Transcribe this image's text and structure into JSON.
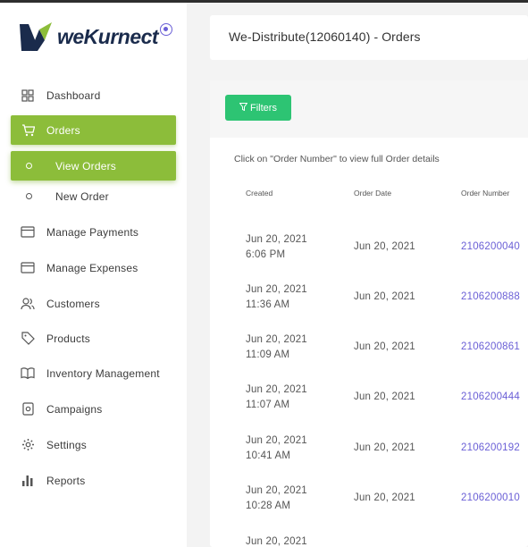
{
  "brand": {
    "name": "weKurnect"
  },
  "sidebar": {
    "items": [
      {
        "label": "Dashboard",
        "icon": "grid-icon"
      },
      {
        "label": "Orders",
        "icon": "cart-icon"
      },
      {
        "label": "View Orders",
        "icon": "circle-icon"
      },
      {
        "label": "New Order",
        "icon": "circle-icon"
      },
      {
        "label": "Manage Payments",
        "icon": "card-icon"
      },
      {
        "label": "Manage Expenses",
        "icon": "card-icon"
      },
      {
        "label": "Customers",
        "icon": "users-icon"
      },
      {
        "label": "Products",
        "icon": "tag-icon"
      },
      {
        "label": "Inventory Management",
        "icon": "book-icon"
      },
      {
        "label": "Campaigns",
        "icon": "campaign-icon"
      },
      {
        "label": "Settings",
        "icon": "gear-icon"
      },
      {
        "label": "Reports",
        "icon": "bar-chart-icon"
      }
    ]
  },
  "header": {
    "title": "We-Distribute(12060140) - Orders"
  },
  "main": {
    "filters_label": "Filters",
    "hint": "Click on \"Order Number\" to view full Order details",
    "columns": [
      "Created",
      "Order Date",
      "Order Number"
    ],
    "rows": [
      {
        "created_date": "Jun 20, 2021",
        "created_time": "6:06 PM",
        "order_date": "Jun 20, 2021",
        "order_number": "2106200040"
      },
      {
        "created_date": "Jun 20, 2021",
        "created_time": "11:36 AM",
        "order_date": "Jun 20, 2021",
        "order_number": "2106200888"
      },
      {
        "created_date": "Jun 20, 2021",
        "created_time": "11:09 AM",
        "order_date": "Jun 20, 2021",
        "order_number": "2106200861"
      },
      {
        "created_date": "Jun 20, 2021",
        "created_time": "11:07 AM",
        "order_date": "Jun 20, 2021",
        "order_number": "2106200444"
      },
      {
        "created_date": "Jun 20, 2021",
        "created_time": "10:41 AM",
        "order_date": "Jun 20, 2021",
        "order_number": "2106200192"
      },
      {
        "created_date": "Jun 20, 2021",
        "created_time": "10:28 AM",
        "order_date": "Jun 20, 2021",
        "order_number": "2106200010"
      },
      {
        "created_date": "Jun 20, 2021",
        "created_time": "",
        "order_date": "",
        "order_number": ""
      }
    ]
  },
  "colors": {
    "accent_green": "#8cbd3a",
    "filters_green": "#2dc473",
    "link_purple": "#6a5fd6"
  }
}
